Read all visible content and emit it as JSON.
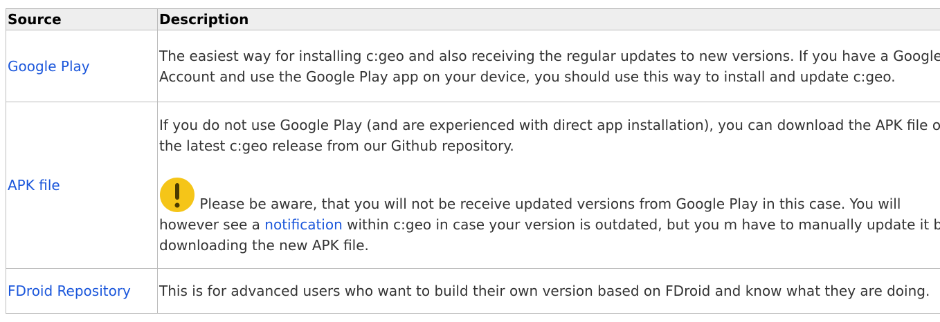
{
  "table": {
    "headers": [
      "Source",
      "Description"
    ],
    "rows": [
      {
        "source": "Google Play",
        "description": "The easiest way for installing c:geo and also receiving the regular updates to new versions. If you have a Google Account and use the Google Play app on your device, you should use this way to install and update c:geo."
      },
      {
        "source": "APK file",
        "description_p1": "If you do not use Google Play (and are experienced with direct app installation), you can download the APK file of the latest c:geo release from our Github repository.",
        "note_before_link": " Please be aware, that you will not be receive updated versions from Google Play in this case. You will however see a ",
        "note_link": "notification",
        "note_after_link": " within c:geo in case your version is outdated, but you m have to manually update it by downloading the new APK file."
      },
      {
        "source": "FDroid Repository",
        "description": "This is for advanced users who want to build their own version based on FDroid and know what they are doing."
      }
    ]
  },
  "icons": {
    "warning": "exclamation-warning-icon"
  },
  "colors": {
    "link": "#1a56db",
    "header_bg": "#eeeeee",
    "border": "#bbbbbb",
    "warning_circle": "#f5c518"
  }
}
